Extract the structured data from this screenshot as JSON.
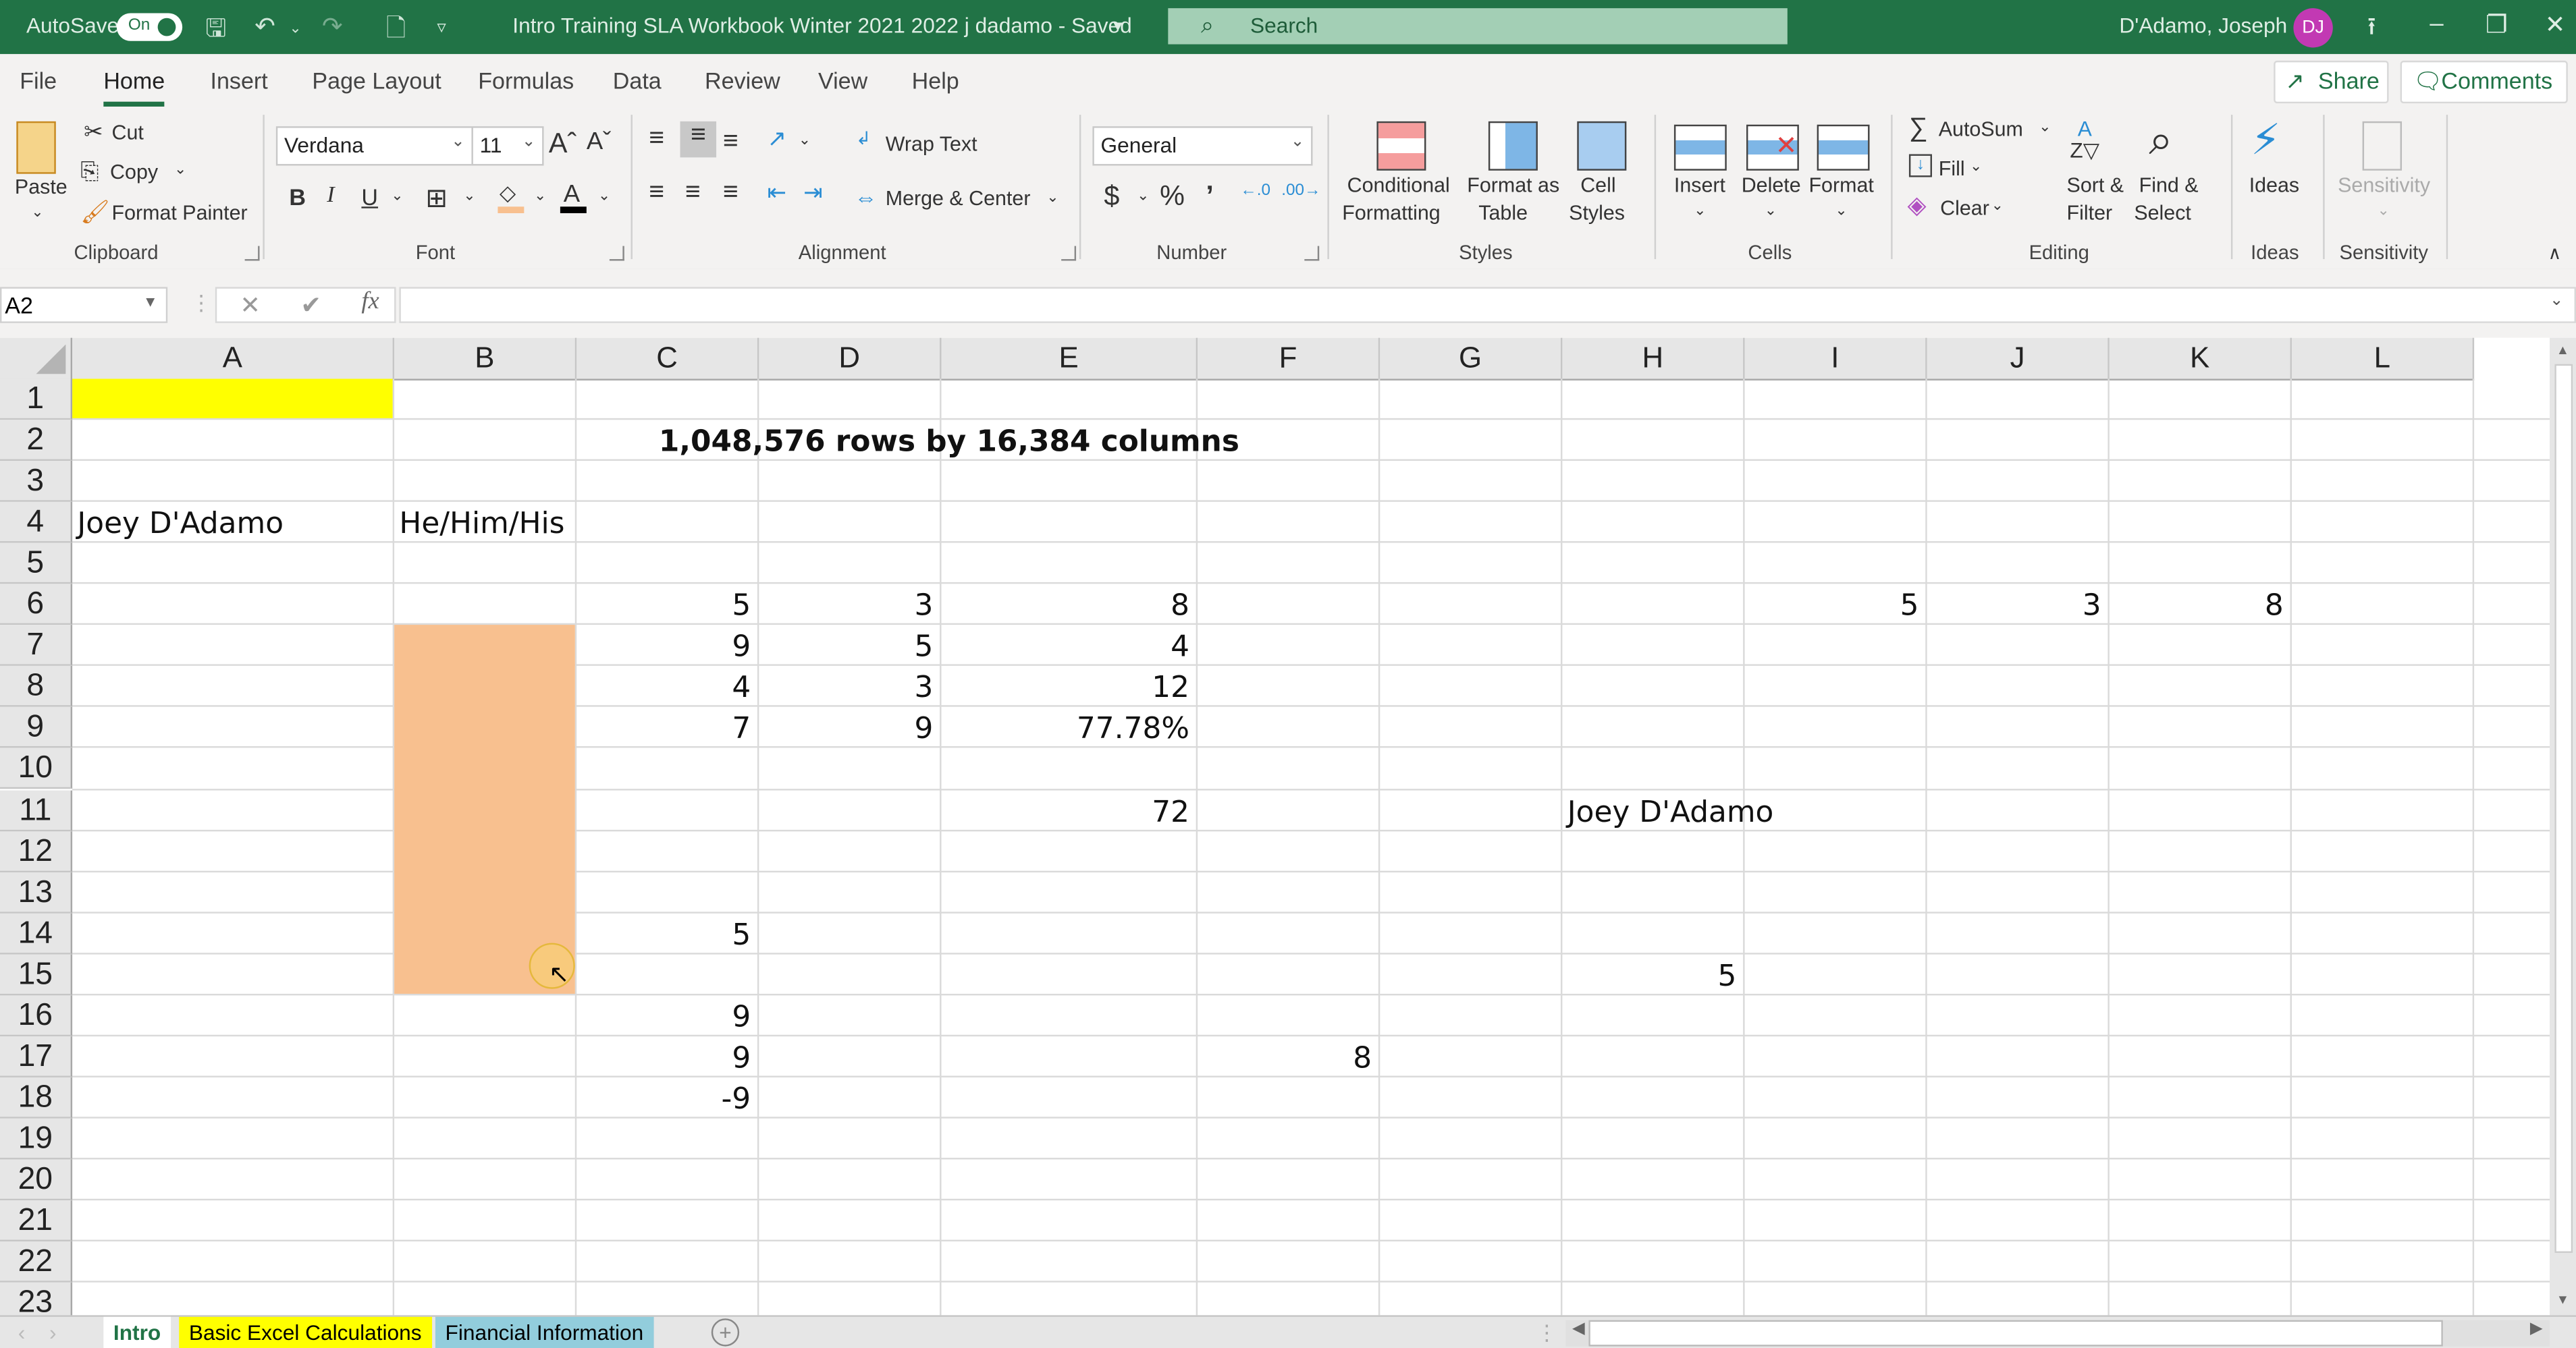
{
  "titlebar": {
    "autosave_label": "AutoSave",
    "autosave_state": "On",
    "doc_title": "Intro Training SLA Workbook Winter 2021 2022 j dadamo  -  Saved",
    "search_placeholder": "Search",
    "user_name": "D'Adamo, Joseph",
    "user_initials": "DJ",
    "avatar_color": "#c239b3"
  },
  "ribbon_tabs": [
    "File",
    "Home",
    "Insert",
    "Page Layout",
    "Formulas",
    "Data",
    "Review",
    "View",
    "Help"
  ],
  "active_tab": "Home",
  "share_label": "Share",
  "comments_label": "Comments",
  "ribbon": {
    "clipboard": {
      "paste": "Paste",
      "cut": "Cut",
      "copy": "Copy",
      "format_painter": "Format Painter",
      "label": "Clipboard"
    },
    "font": {
      "font_name": "Verdana",
      "font_size": "11",
      "label": "Font",
      "bold": "B",
      "italic": "I",
      "underline": "U"
    },
    "alignment": {
      "wrap_text": "Wrap Text",
      "merge_center": "Merge & Center",
      "label": "Alignment"
    },
    "number": {
      "format": "General",
      "label": "Number",
      "currency": "$",
      "percent": "%",
      "comma": "9"
    },
    "styles": {
      "conditional_1": "Conditional",
      "conditional_2": "Formatting",
      "format_table_1": "Format as",
      "format_table_2": "Table",
      "cell_styles_1": "Cell",
      "cell_styles_2": "Styles",
      "label": "Styles"
    },
    "cells": {
      "insert": "Insert",
      "delete": "Delete",
      "format": "Format",
      "label": "Cells"
    },
    "editing": {
      "autosum": "AutoSum",
      "fill": "Fill",
      "clear": "Clear",
      "sort_1": "Sort &",
      "sort_2": "Filter",
      "find_1": "Find &",
      "find_2": "Select",
      "label": "Editing"
    },
    "ideas": {
      "button": "Ideas",
      "label": "Ideas"
    },
    "sensitivity": {
      "button": "Sensitivity",
      "label": "Sensitivity"
    }
  },
  "formula_bar": {
    "name_box": "A2",
    "formula": "",
    "fx": "fx"
  },
  "grid": {
    "columns": [
      "A",
      "B",
      "C",
      "D",
      "E",
      "F",
      "G",
      "H",
      "I",
      "J",
      "K",
      "L"
    ],
    "rows": [
      "1",
      "2",
      "3",
      "4",
      "5",
      "6",
      "7",
      "8",
      "9",
      "10",
      "11",
      "12",
      "13",
      "14",
      "15",
      "16",
      "17",
      "18",
      "19",
      "20",
      "21",
      "22",
      "23"
    ],
    "cells": {
      "C2": "1,048,576 rows by 16,384 columns",
      "A4": "Joey D'Adamo",
      "B4": "He/Him/His",
      "C6": "5",
      "D6": "3",
      "E6": "8",
      "I6": "5",
      "J6": "3",
      "K6": "8",
      "C7": "9",
      "D7": "5",
      "E7": "4",
      "C8": "4",
      "D8": "3",
      "E8": "12",
      "C9": "7",
      "D9": "9",
      "E9": "77.78%",
      "E11": "72",
      "H11": "Joey D'Adamo",
      "C14": "5",
      "H15": "5",
      "C16": "9",
      "C17": "9",
      "F17": "8",
      "C18": "-9"
    },
    "fills": {
      "A1": "#ffff00",
      "B7:B15": "#f8c08f"
    }
  },
  "sheets": [
    {
      "name": "Intro",
      "active": true,
      "color": "#ffffff"
    },
    {
      "name": "Basic Excel Calculations",
      "active": false,
      "color": "#ffff00"
    },
    {
      "name": "Financial Information",
      "active": false,
      "color": "#92cddc"
    }
  ]
}
